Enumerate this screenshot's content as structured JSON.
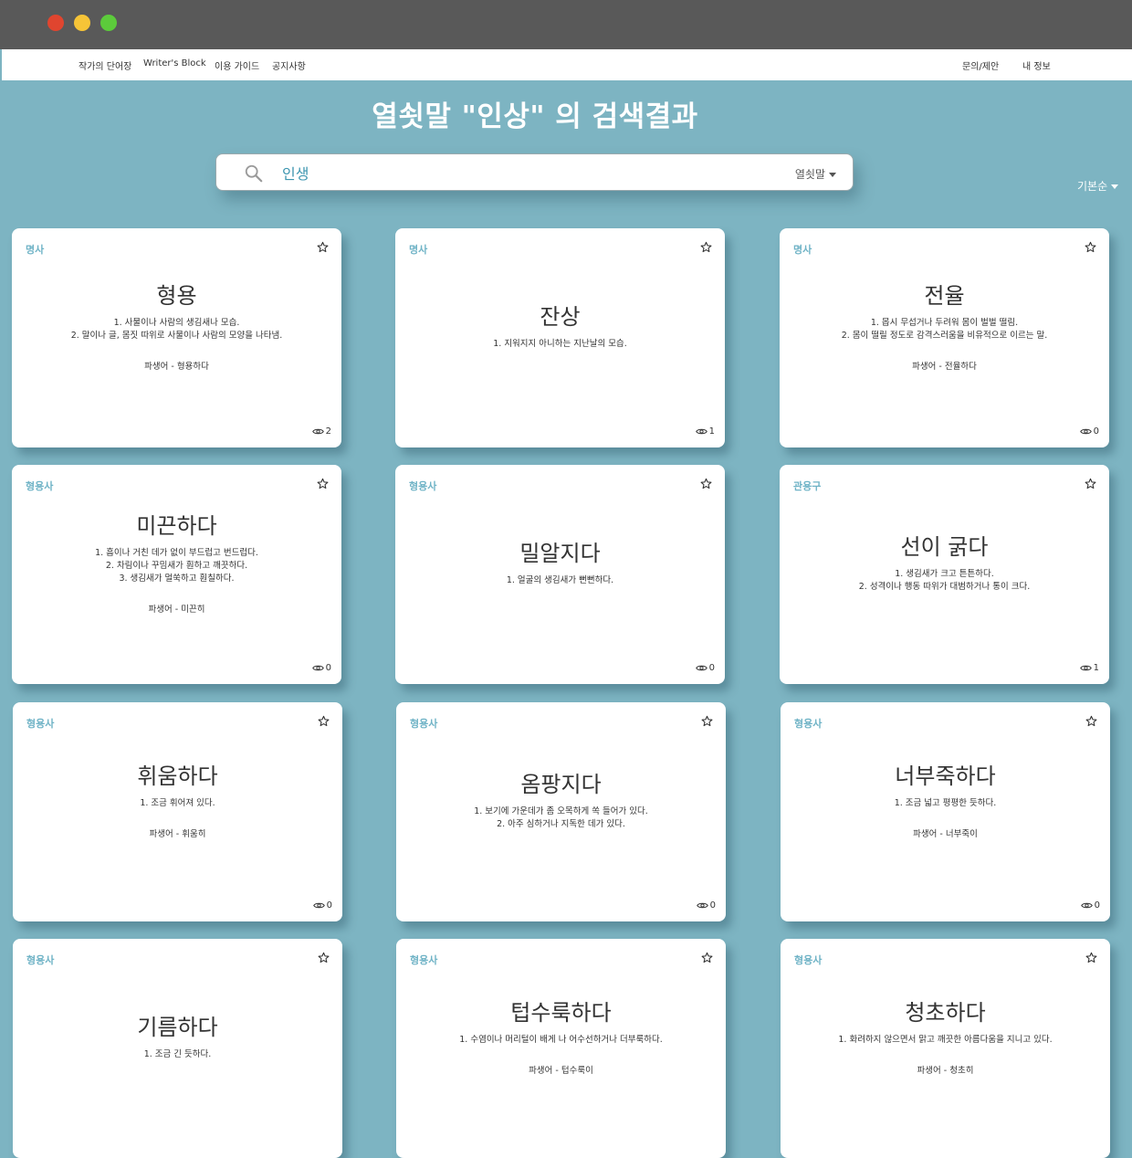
{
  "nav": {
    "left": [
      "작가의 단어장",
      "Writer's Block",
      "이용 가이드",
      "공지사항"
    ],
    "right": [
      "문의/제안",
      "내 정보"
    ]
  },
  "page_title": "열쇳말 \"인상\" 의 검색결과",
  "search": {
    "value": "인생",
    "type_label": "열쇳말"
  },
  "sort_label": "기본순",
  "cards": [
    {
      "pos": "명사",
      "word": "형용",
      "defs": [
        "1. 사물이나 사람의 생김새나 모습.",
        "2. 말이나 글, 몸짓 따위로 사물이나 사람의 모양을 나타냄."
      ],
      "derived": "파생어 - 형용하다",
      "views": "2"
    },
    {
      "pos": "명사",
      "word": "잔상",
      "defs": [
        "1. 지워지지 아니하는 지난날의 모습."
      ],
      "derived": "",
      "views": "1"
    },
    {
      "pos": "명사",
      "word": "전율",
      "defs": [
        "1. 몹시 무섭거나 두려워 몸이 벌벌 떨림.",
        "2. 몸이 떨릴 정도로 감격스러움을 비유적으로 이르는 말."
      ],
      "derived": "파생어 - 전율하다",
      "views": "0"
    },
    {
      "pos": "형용사",
      "word": "미끈하다",
      "defs": [
        "1. 흠이나 거친 데가 없이 부드럽고 번드럽다.",
        "2. 차림이나 꾸밈새가 훤하고 깨끗하다.",
        "3. 생김새가 멀쑥하고 훤칠하다."
      ],
      "derived": "파생어 - 미끈히",
      "views": "0"
    },
    {
      "pos": "형용사",
      "word": "밀알지다",
      "defs": [
        "1. 얼굴의 생김새가 뻔뻔하다."
      ],
      "derived": "",
      "views": "0"
    },
    {
      "pos": "관용구",
      "word": "선이 굵다",
      "defs": [
        "1. 생김새가 크고 튼튼하다.",
        "2. 성격이나 행동 따위가 대범하거나 통이 크다."
      ],
      "derived": "",
      "views": "1"
    },
    {
      "pos": "형용사",
      "word": "휘움하다",
      "defs": [
        "1. 조금 휘어져 있다."
      ],
      "derived": "파생어 - 휘움히",
      "views": "0"
    },
    {
      "pos": "형용사",
      "word": "옴팡지다",
      "defs": [
        "1. 보기에 가운데가 좀 오목하게 쏙 들어가 있다.",
        "2. 아주 심하거나 지독한 데가 있다."
      ],
      "derived": "",
      "views": "0"
    },
    {
      "pos": "형용사",
      "word": "너부죽하다",
      "defs": [
        "1. 조금 넓고 평평한 듯하다."
      ],
      "derived": "파생어 - 너부죽이",
      "views": "0"
    },
    {
      "pos": "형용사",
      "word": "기름하다",
      "defs": [
        "1. 조금 긴 듯하다."
      ],
      "derived": "",
      "views": ""
    },
    {
      "pos": "형용사",
      "word": "텁수룩하다",
      "defs": [
        "1. 수염이나 머리털이 배게 나 어수선하거나 더부룩하다."
      ],
      "derived": "파생어 - 텁수룩이",
      "views": ""
    },
    {
      "pos": "형용사",
      "word": "청초하다",
      "defs": [
        "1. 화려하지 않으면서 맑고 깨끗한 아름다움을 지니고 있다."
      ],
      "derived": "파생어 - 청초히",
      "views": ""
    }
  ]
}
